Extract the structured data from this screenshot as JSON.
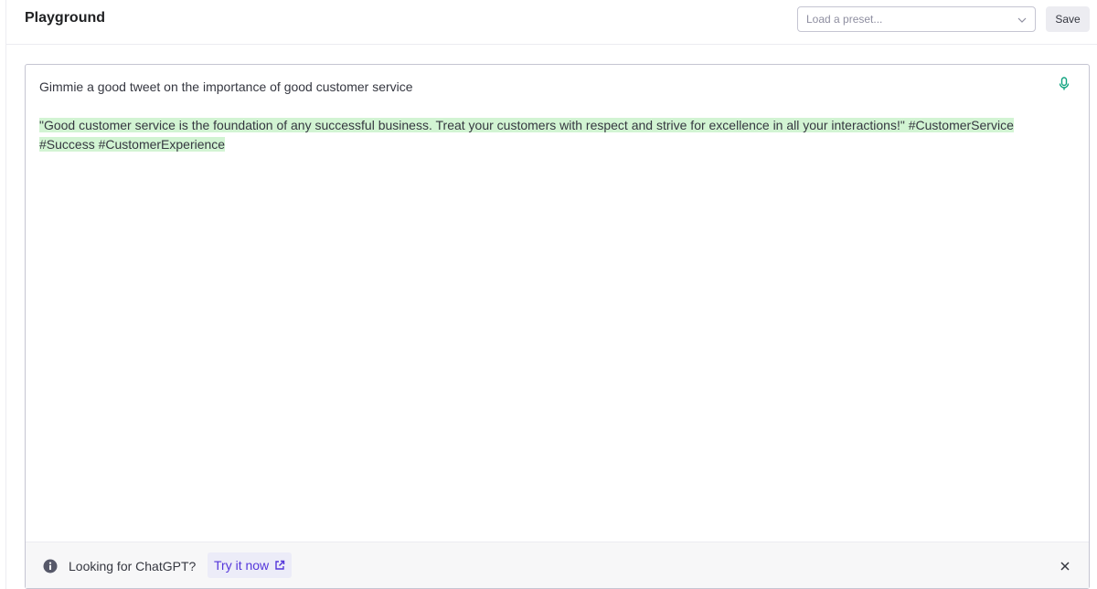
{
  "header": {
    "title": "Playground",
    "preset_placeholder": "Load a preset...",
    "save_label": "Save"
  },
  "editor": {
    "prompt": "Gimmie a good tweet on the importance of good customer service",
    "completion": "\"Good customer service is the foundation of any successful business. Treat your customers with respect and strive for excellence in all your interactions!\" #CustomerService #Success #CustomerExperience",
    "mic_icon": "microphone-icon",
    "completion_highlight_color": "#d2f4d3"
  },
  "banner": {
    "text": "Looking for ChatGPT?",
    "link_label": "Try it now",
    "info_icon": "info-icon",
    "link_icon": "external-link-icon",
    "close_icon": "close-icon",
    "link_color": "#5436da"
  }
}
